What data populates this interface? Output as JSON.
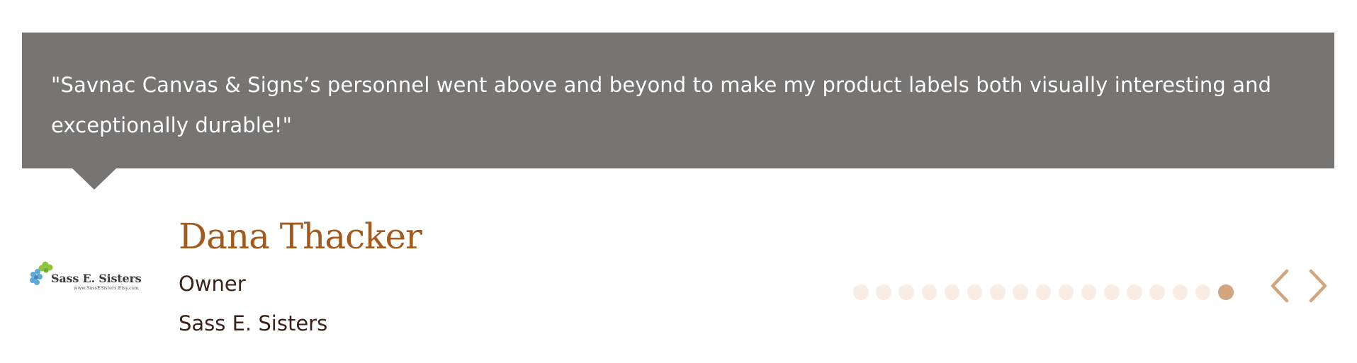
{
  "testimonial": {
    "quote": "\"Savnac Canvas & Signs’s personnel went above and beyond to make my product labels both visually interesting and exceptionally durable!\"",
    "author_name": "Dana Thacker",
    "author_role": "Owner",
    "author_company": "Sass E. Sisters",
    "logo": {
      "brand_text": "Sass E. Sisters",
      "url_text": "www.SassESisters.Etsy.com"
    }
  },
  "carousel": {
    "slide_count": 17,
    "active_index": 16,
    "prev_icon": "chevron-left-icon",
    "next_icon": "chevron-right-icon"
  },
  "colors": {
    "quote_background": "#767574",
    "quote_text": "#ffffff",
    "author_name": "#a45a1c",
    "author_details": "#3a2218",
    "dot_inactive": "#f9ece2",
    "dot_active": "#d3a57f",
    "arrow": "#d3a57f"
  }
}
